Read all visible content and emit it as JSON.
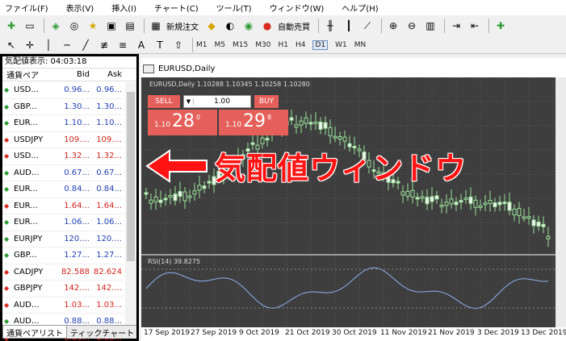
{
  "menu": [
    "ファイル(F)",
    "表示(V)",
    "挿入(I)",
    "チャート(C)",
    "ツール(T)",
    "ウィンドウ(W)",
    "ヘルプ(H)"
  ],
  "toolbar": {
    "new_order_label": "新規注文",
    "auto_trade_label": "自動売買",
    "timeframes": [
      "M1",
      "M5",
      "M15",
      "M30",
      "H1",
      "H4",
      "D1",
      "W1",
      "MN"
    ],
    "active_timeframe": "D1"
  },
  "market_watch": {
    "title": "気配値表示: 04:03:18",
    "headers": {
      "symbol": "通貨ペア",
      "bid": "Bid",
      "ask": "Ask"
    },
    "rows": [
      {
        "symbol": "USD...",
        "bid": "0.96...",
        "ask": "0.96...",
        "dir": "up"
      },
      {
        "symbol": "GBP...",
        "bid": "1.30...",
        "ask": "1.30...",
        "dir": "up"
      },
      {
        "symbol": "EUR...",
        "bid": "1.10...",
        "ask": "1.10...",
        "dir": "up"
      },
      {
        "symbol": "USDJPY",
        "bid": "109....",
        "ask": "109....",
        "dir": "down"
      },
      {
        "symbol": "USD...",
        "bid": "1.32...",
        "ask": "1.32...",
        "dir": "down"
      },
      {
        "symbol": "AUD...",
        "bid": "0.67...",
        "ask": "0.67...",
        "dir": "up"
      },
      {
        "symbol": "EUR...",
        "bid": "0.84...",
        "ask": "0.84...",
        "dir": "up"
      },
      {
        "symbol": "EUR...",
        "bid": "1.64...",
        "ask": "1.64...",
        "dir": "down"
      },
      {
        "symbol": "EUR...",
        "bid": "1.06...",
        "ask": "1.06...",
        "dir": "up"
      },
      {
        "symbol": "EURJPY",
        "bid": "120....",
        "ask": "120....",
        "dir": "up"
      },
      {
        "symbol": "GBP...",
        "bid": "1.27...",
        "ask": "1.27...",
        "dir": "up"
      },
      {
        "symbol": "CADJPY",
        "bid": "82.588",
        "ask": "82.624",
        "dir": "down"
      },
      {
        "symbol": "GBPJPY",
        "bid": "142....",
        "ask": "142....",
        "dir": "down"
      },
      {
        "symbol": "AUD...",
        "bid": "1.03...",
        "ask": "1.03...",
        "dir": "down"
      },
      {
        "symbol": "AUD...",
        "bid": "0.88...",
        "ask": "0.88...",
        "dir": "up"
      },
      {
        "symbol": "AUD...",
        "bid": "0.65...",
        "ask": "0.65...",
        "dir": "down"
      }
    ],
    "tabs": [
      "通貨ペアリスト",
      "ティックチャート"
    ]
  },
  "chart": {
    "tab_title": "EURUSD,Daily",
    "info": "EURUSD,Daily  1.10288 1.10345 1.10258 1.10280",
    "trade": {
      "sell_label": "SELL",
      "buy_label": "BUY",
      "lot": "1.00",
      "sell_prefix": "1.10",
      "sell_big": "28",
      "sell_sup": "0",
      "buy_prefix": "1.10",
      "buy_big": "29",
      "buy_sup": "8"
    },
    "rsi_label": "RSI(14) 39.8275",
    "dates": [
      "17 Sep 2019",
      "27 Sep 2019",
      "9 Oct 2019",
      "21 Oct 2019",
      "30 Oct 2019",
      "11 Nov 2019",
      "21 Nov 2019",
      "3 Dec 2019",
      "13 Dec 2019"
    ]
  },
  "annotation": "気配値ウィンドウ",
  "colors": {
    "bid_ask_up": "#1f3fb0",
    "bid_ask_down": "#d0231b",
    "annotation": "#ff1212",
    "chart_bg": "#3e3e3e",
    "trade_red": "#e5605a"
  }
}
